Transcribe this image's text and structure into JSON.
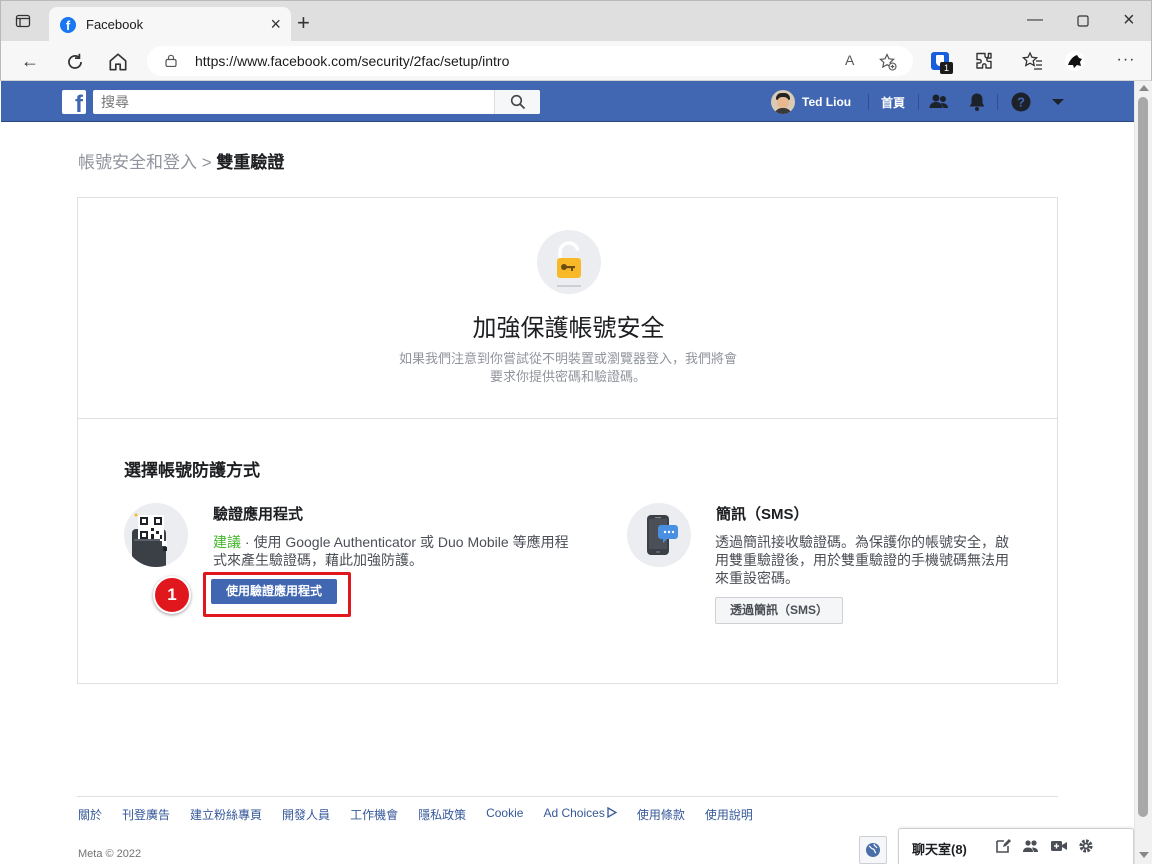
{
  "browser": {
    "tab_title": "Facebook",
    "url": "https://www.facebook.com/security/2fac/setup/intro",
    "read_aloud": "A",
    "extension_badge": "1"
  },
  "fb_header": {
    "search_placeholder": "搜尋",
    "user_name": "Ted Liou",
    "home_label": "首頁",
    "logo_letter": "f"
  },
  "breadcrumb": {
    "parent": "帳號安全和登入",
    "separator": ">",
    "current": "雙重驗證"
  },
  "hero": {
    "title": "加強保護帳號安全",
    "description": "如果我們注意到你嘗試從不明裝置或瀏覽器登入，我們將會要求你提供密碼和驗證碼。"
  },
  "section": {
    "title": "選擇帳號防護方式"
  },
  "options": {
    "app": {
      "title": "驗證應用程式",
      "recommend": "建議",
      "description": " · 使用 Google Authenticator 或 Duo Mobile 等應用程式來產生驗證碼，藉此加強防護。",
      "button": "使用驗證應用程式"
    },
    "sms": {
      "title": "簡訊（SMS）",
      "description": "透過簡訊接收驗證碼。為保護你的帳號安全，啟用雙重驗證後，用於雙重驗證的手機號碼無法用來重設密碼。",
      "button": "透過簡訊（SMS）"
    }
  },
  "annotation": {
    "step_number": "1"
  },
  "footer": {
    "links": [
      "關於",
      "刊登廣告",
      "建立粉絲專頁",
      "開發人員",
      "工作機會",
      "隱私政策",
      "Cookie",
      "Ad Choices",
      "使用條款",
      "使用說明"
    ],
    "copyright": "Meta © 2022"
  },
  "chat": {
    "label": "聊天室(8)"
  },
  "colors": {
    "fb_blue": "#4267b2",
    "highlight_red": "#e1171e",
    "recommend_green": "#42b72a"
  }
}
